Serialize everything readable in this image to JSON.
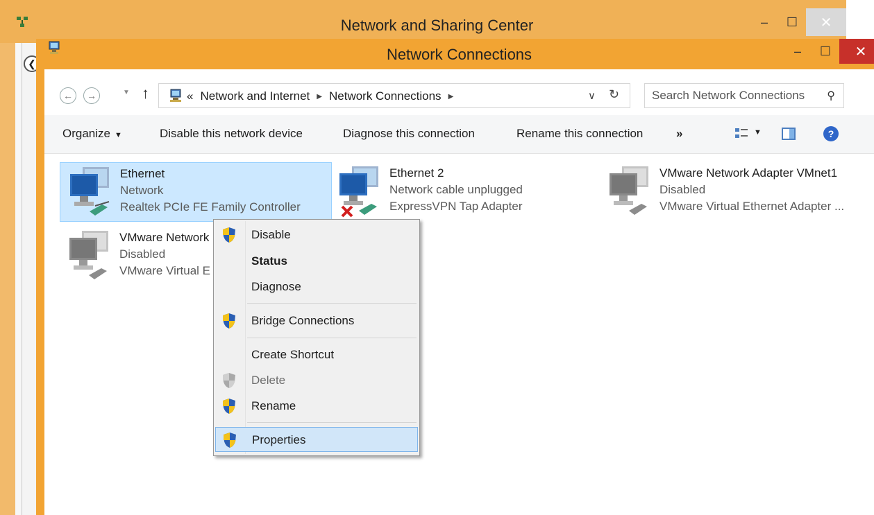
{
  "back_window": {
    "title": "Network and Sharing Center",
    "minimize": "–",
    "maximize": "☐",
    "close": "✕",
    "back_glyph": "❮"
  },
  "window": {
    "title": "Network Connections",
    "minimize": "–",
    "maximize": "☐",
    "close": "✕"
  },
  "nav": {
    "back_glyph": "←",
    "forward_glyph": "→",
    "recent_glyph": "▼",
    "up_glyph": "↑"
  },
  "address": {
    "overflow": "«",
    "crumbs": [
      "Network and Internet",
      "Network Connections"
    ],
    "sep": "▶",
    "dropdown_glyph": "∨",
    "refresh_glyph": "↻"
  },
  "search": {
    "placeholder": "Search Network Connections",
    "icon_glyph": "⚲"
  },
  "toolbar": {
    "organize": "Organize",
    "caret": "▼",
    "disable": "Disable this network device",
    "diagnose": "Diagnose this connection",
    "rename": "Rename this connection",
    "more": "»",
    "help": "?"
  },
  "connections": [
    {
      "name": "Ethernet",
      "status": "Network",
      "device": "Realtek PCIe FE Family Controller"
    },
    {
      "name": "Ethernet 2",
      "status": "Network cable unplugged",
      "device": "ExpressVPN Tap Adapter"
    },
    {
      "name": "VMware Network Adapter VMnet1",
      "status": "Disabled",
      "device": "VMware Virtual Ethernet Adapter ..."
    },
    {
      "name": "VMware Network",
      "status": "Disabled",
      "device": "VMware Virtual E"
    }
  ],
  "context_menu": {
    "items": [
      "Disable",
      "Status",
      "Diagnose",
      "Bridge Connections",
      "Create Shortcut",
      "Delete",
      "Rename",
      "Properties"
    ]
  },
  "colors": {
    "titlebar_orange": "#f2a433",
    "close_red": "#c7302a",
    "selection_blue": "#cce8ff",
    "shield_blue": "#2b5fb3",
    "shield_yellow": "#f3c21b"
  }
}
